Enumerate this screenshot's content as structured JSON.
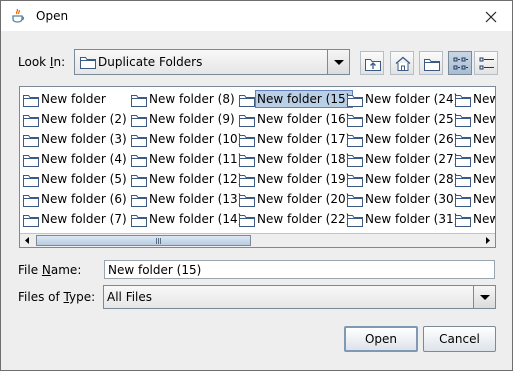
{
  "window": {
    "title": "Open",
    "close_icon": "close-icon",
    "app_icon": "java-cup-icon"
  },
  "look_in": {
    "label_pre": "Look ",
    "label_mnemonic": "I",
    "label_post": "n:",
    "value": "Duplicate Folders"
  },
  "toolbar": {
    "up_icon": "up-one-level-icon",
    "home_icon": "home-icon",
    "new_folder_icon": "new-folder-icon",
    "list_icon": "list-view-icon",
    "details_icon": "details-view-icon"
  },
  "file_list": {
    "selected": "New folder (15)",
    "columns": [
      [
        "New folder",
        "New folder (2)",
        "New folder (3)",
        "New folder (4)",
        "New folder (5)",
        "New folder (6)",
        "New folder (7)"
      ],
      [
        "New folder (8)",
        "New folder (9)",
        "New folder (10)",
        "New folder (11)",
        "New folder (12)",
        "New folder (13)",
        "New folder (14)"
      ],
      [
        "New folder (15)",
        "New folder (16)",
        "New folder (17)",
        "New folder (18)",
        "New folder (19)",
        "New folder (20)",
        "New folder (22)"
      ],
      [
        "New folder (24)",
        "New folder (25)",
        "New folder (26)",
        "New folder (27)",
        "New folder (28)",
        "New folder (30)",
        "New folder (31)"
      ],
      [
        "New",
        "New",
        "New",
        "New",
        "New",
        "New",
        "New"
      ]
    ]
  },
  "file_name": {
    "label_pre": "File ",
    "label_mnemonic": "N",
    "label_post": "ame:",
    "value": "New folder (15)"
  },
  "files_of_type": {
    "label_pre": "Files of ",
    "label_mnemonic": "T",
    "label_post": "ype:",
    "value": "All Files"
  },
  "buttons": {
    "open": "Open",
    "cancel": "Cancel"
  }
}
